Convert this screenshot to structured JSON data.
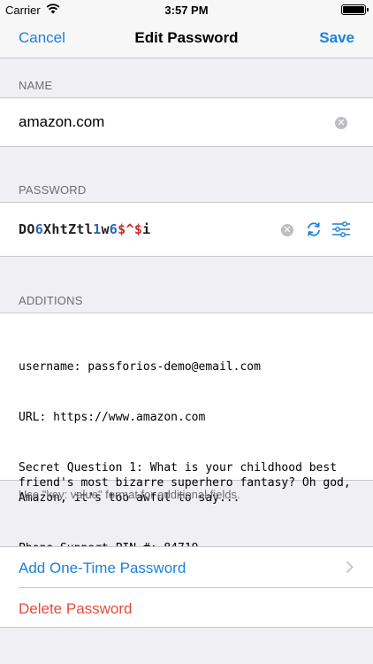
{
  "status_bar": {
    "carrier": "Carrier",
    "time": "3:57 PM"
  },
  "nav": {
    "cancel": "Cancel",
    "title": "Edit Password",
    "save": "Save"
  },
  "name_section": {
    "header": "NAME",
    "value": "amazon.com"
  },
  "password_section": {
    "header": "PASSWORD",
    "password_chars": [
      "D",
      "O",
      "6",
      "X",
      "h",
      "t",
      "Z",
      "t",
      "l",
      "1",
      "w",
      "6",
      "$",
      "^",
      "$",
      "i"
    ]
  },
  "additions_section": {
    "header": "ADDITIONS",
    "lines": [
      "username: passforios-demo@email.com",
      "URL: https://www.amazon.com",
      "Secret Question 1: What is your childhood best friend's most bizarre superhero fantasy? Oh god, Amazon, it's too awful to say...",
      "Phone Support PIN #: 84719"
    ],
    "footer": "Use \"key: value\" format for additional fields."
  },
  "actions": {
    "add_otp": "Add One-Time Password",
    "delete": "Delete Password"
  },
  "colors": {
    "accent": "#1a82d9",
    "destructive": "#e74c3c",
    "digit": "#2b63c6",
    "symbol": "#c63028"
  },
  "icons": [
    "wifi-icon",
    "battery-icon",
    "clear-icon",
    "refresh-icon",
    "sliders-icon",
    "chevron-right-icon"
  ]
}
